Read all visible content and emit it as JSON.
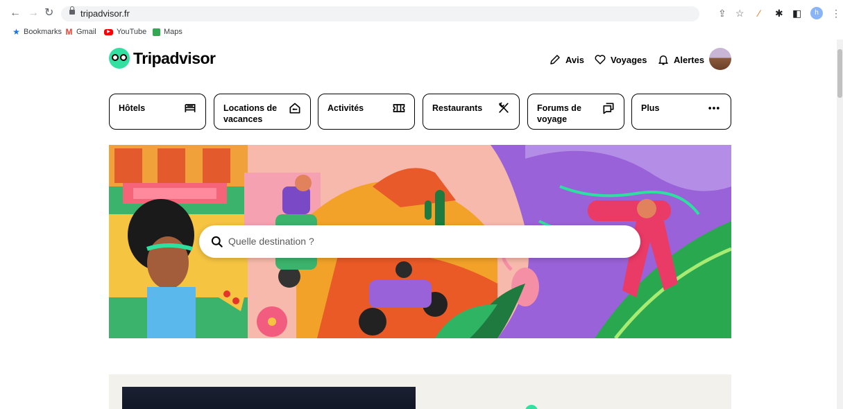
{
  "browser": {
    "url": "tripadvisor.fr",
    "profile_initial": "h",
    "bookmarks": [
      {
        "label": "Bookmarks",
        "icon": "star-icon",
        "color": "#1a73e8"
      },
      {
        "label": "Gmail",
        "icon": "gmail-icon",
        "color": "#ea4335"
      },
      {
        "label": "YouTube",
        "icon": "youtube-icon",
        "color": "#ff0000"
      },
      {
        "label": "Maps",
        "icon": "maps-icon",
        "color": "#34a853"
      }
    ]
  },
  "header": {
    "logo_text": "Tripadvisor",
    "links": {
      "avis": "Avis",
      "voyages": "Voyages",
      "alertes": "Alertes"
    }
  },
  "categories": [
    {
      "label": "Hôtels",
      "icon": "bed-icon"
    },
    {
      "label": "Locations de vacances",
      "icon": "house-icon"
    },
    {
      "label": "Activités",
      "icon": "ticket-icon"
    },
    {
      "label": "Restaurants",
      "icon": "fork-knife-icon"
    },
    {
      "label": "Forums de voyage",
      "icon": "chat-icon"
    },
    {
      "label": "Plus",
      "icon": "more-dots-icon"
    }
  ],
  "search": {
    "placeholder": "Quelle destination ?"
  },
  "colors": {
    "brand_green": "#34e0a1",
    "text": "#000000"
  }
}
